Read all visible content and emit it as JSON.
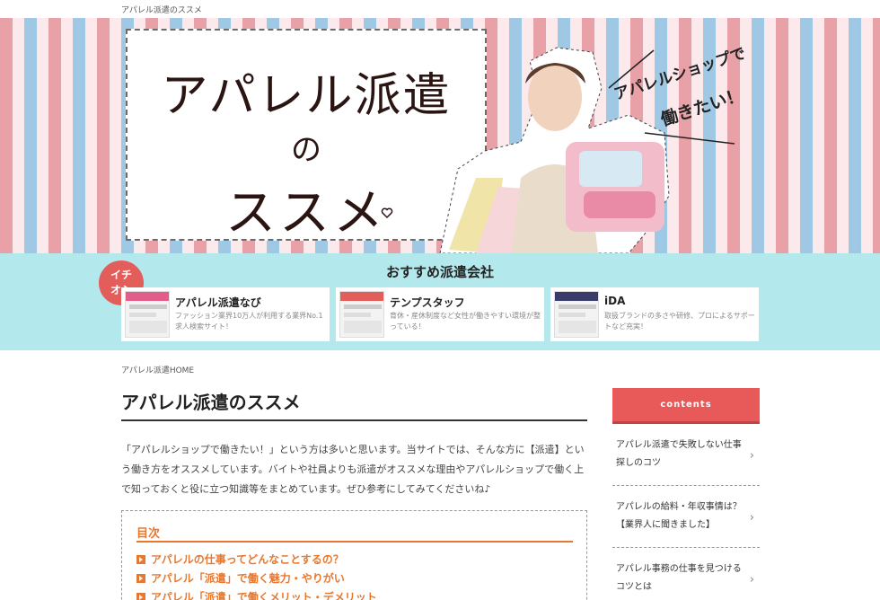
{
  "site": {
    "name": "アパレル派遣のススメ"
  },
  "hero": {
    "title_line1": "アパレル派遣",
    "title_line2": "の",
    "title_line3": "ススメ",
    "speech_line1": "アパレルショップで",
    "speech_line2": "働きたい！"
  },
  "recommend": {
    "heading": "おすすめ派遣会社",
    "badge_line1": "イチ",
    "badge_line2": "オシ",
    "cards": [
      {
        "name": "アパレル派遣なび",
        "desc": "ファッション業界10万人が利用する業界No.1求人検索サイト！",
        "accent": "#e35d8b"
      },
      {
        "name": "テンプスタッフ",
        "desc": "育休・産休制度など女性が働きやすい環境が整っている！",
        "accent": "#e35d5b"
      },
      {
        "name": "iDA",
        "desc": "取扱ブランドの多さや研修、プロによるサポートなど充実！",
        "accent": "#3b3b6b"
      }
    ]
  },
  "breadcrumb": "アパレル派遣HOME",
  "main": {
    "title": "アパレル派遣のススメ",
    "intro": "「アパレルショップで働きたい！」という方は多いと思います。当サイトでは、そんな方に【派遣】という働き方をオススメしています。バイトや社員よりも派遣がオススメな理由やアパレルショップで働く上で知っておくと役に立つ知識等をまとめています。ぜひ参考にしてみてくださいね♪"
  },
  "toc": {
    "title": "目次",
    "items": [
      "アパレルの仕事ってどんなことするの？",
      "アパレル「派遣」で働く魅力・やりがい",
      "アパレル「派遣」で働くメリット・デメリット"
    ]
  },
  "sidebar": {
    "heading": "contents",
    "items": [
      "アパレル派遣で失敗しない仕事探しのコツ",
      "アパレルの給料・年収事情は？【業界人に聞きました】",
      "アパレル事務の仕事を見つけるコツとは"
    ]
  },
  "colors": {
    "accent_red": "#e8595a",
    "accent_orange": "#e6782f",
    "band_teal": "#b3e8ec"
  }
}
